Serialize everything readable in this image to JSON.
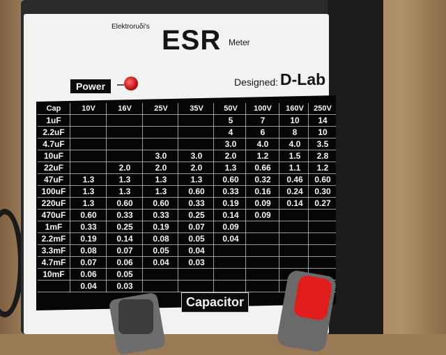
{
  "panel": {
    "brand": "Elektroruδi's",
    "title": "ESR",
    "subtitle": "Meter",
    "power_label": "Power",
    "designed_label": "Designed:",
    "designer": "D-Lab",
    "capacitor_label": "Capacitor"
  },
  "table": {
    "headers": [
      "Cap",
      "10V",
      "16V",
      "25V",
      "35V",
      "50V",
      "100V",
      "160V",
      "250V"
    ],
    "rows": [
      [
        "1uF",
        "",
        "",
        "",
        "",
        "5",
        "7",
        "10",
        "14"
      ],
      [
        "2.2uF",
        "",
        "",
        "",
        "",
        "4",
        "6",
        "8",
        "10"
      ],
      [
        "4.7uF",
        "",
        "",
        "",
        "",
        "3.0",
        "4.0",
        "4.0",
        "3.5"
      ],
      [
        "10uF",
        "",
        "",
        "3.0",
        "3.0",
        "2.0",
        "1.2",
        "1.5",
        "2.8"
      ],
      [
        "22uF",
        "",
        "2.0",
        "2.0",
        "2.0",
        "1.3",
        "0.66",
        "1.1",
        "1.2"
      ],
      [
        "47uF",
        "1.3",
        "1.3",
        "1.3",
        "1.3",
        "0.60",
        "0.32",
        "0.46",
        "0.60"
      ],
      [
        "100uF",
        "1.3",
        "1.3",
        "1.3",
        "0.60",
        "0.33",
        "0.16",
        "0.24",
        "0.30"
      ],
      [
        "220uF",
        "1.3",
        "0.60",
        "0.60",
        "0.33",
        "0.19",
        "0.09",
        "0.14",
        "0.27"
      ],
      [
        "470uF",
        "0.60",
        "0.33",
        "0.33",
        "0.25",
        "0.14",
        "0.09",
        "",
        ""
      ],
      [
        "1mF",
        "0.33",
        "0.25",
        "0.19",
        "0.07",
        "0.09",
        "",
        "",
        ""
      ],
      [
        "2.2mF",
        "0.19",
        "0.14",
        "0.08",
        "0.05",
        "0.04",
        "",
        "",
        ""
      ],
      [
        "3.3mF",
        "0.08",
        "0.07",
        "0.05",
        "0.04",
        "",
        "",
        "",
        ""
      ],
      [
        "4.7mF",
        "0.07",
        "0.06",
        "0.04",
        "0.03",
        "",
        "",
        "",
        ""
      ],
      [
        "10mF",
        "0.06",
        "0.05",
        "",
        "",
        "",
        "",
        "",
        ""
      ],
      [
        "",
        "0.04",
        "0.03",
        "",
        "",
        "",
        "",
        "",
        ""
      ]
    ]
  }
}
